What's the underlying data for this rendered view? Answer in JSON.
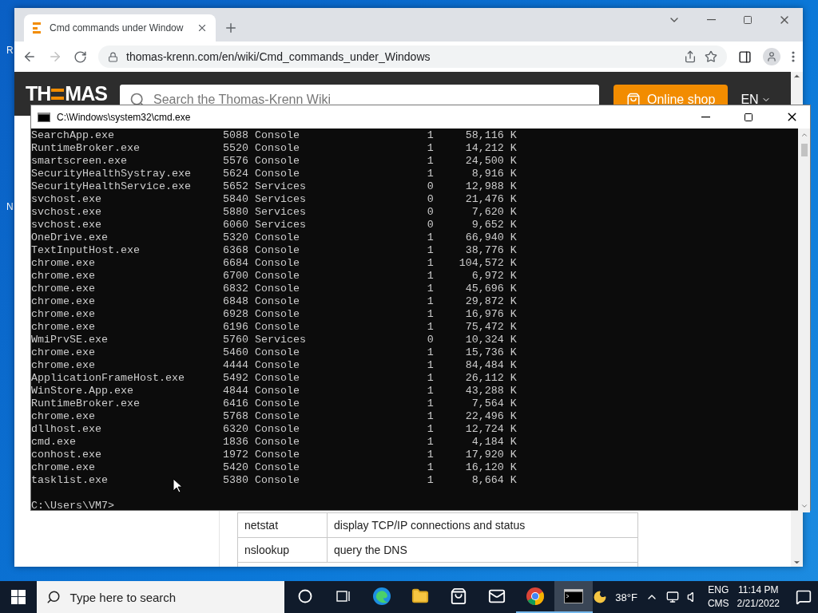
{
  "desktop": {
    "icon_labels": [
      "R",
      "N"
    ]
  },
  "browser": {
    "tabs": [
      {
        "title": "Cmd commands under Window",
        "selected": true
      }
    ],
    "address": "thomas-krenn.com/en/wiki/Cmd_commands_under_Windows",
    "page": {
      "logo": [
        "TH",
        "MAS"
      ],
      "search_placeholder": "Search the Thomas-Krenn Wiki",
      "shop_button": "Online shop",
      "language": "EN",
      "table_rows": [
        [
          "netstat",
          "display TCP/IP connections and status"
        ],
        [
          "nslookup",
          "query the DNS"
        ]
      ]
    }
  },
  "console": {
    "title": "C:\\Windows\\system32\\cmd.exe",
    "processes": [
      {
        "name": "SearchApp.exe",
        "pid": "5088",
        "session": "Console",
        "session_no": "1",
        "mem": "58,116 K"
      },
      {
        "name": "RuntimeBroker.exe",
        "pid": "5520",
        "session": "Console",
        "session_no": "1",
        "mem": "14,212 K"
      },
      {
        "name": "smartscreen.exe",
        "pid": "5576",
        "session": "Console",
        "session_no": "1",
        "mem": "24,500 K"
      },
      {
        "name": "SecurityHealthSystray.exe",
        "pid": "5624",
        "session": "Console",
        "session_no": "1",
        "mem": "8,916 K"
      },
      {
        "name": "SecurityHealthService.exe",
        "pid": "5652",
        "session": "Services",
        "session_no": "0",
        "mem": "12,988 K"
      },
      {
        "name": "svchost.exe",
        "pid": "5840",
        "session": "Services",
        "session_no": "0",
        "mem": "21,476 K"
      },
      {
        "name": "svchost.exe",
        "pid": "5880",
        "session": "Services",
        "session_no": "0",
        "mem": "7,620 K"
      },
      {
        "name": "svchost.exe",
        "pid": "6060",
        "session": "Services",
        "session_no": "0",
        "mem": "9,652 K"
      },
      {
        "name": "OneDrive.exe",
        "pid": "5320",
        "session": "Console",
        "session_no": "1",
        "mem": "66,940 K"
      },
      {
        "name": "TextInputHost.exe",
        "pid": "6368",
        "session": "Console",
        "session_no": "1",
        "mem": "38,776 K"
      },
      {
        "name": "chrome.exe",
        "pid": "6684",
        "session": "Console",
        "session_no": "1",
        "mem": "104,572 K"
      },
      {
        "name": "chrome.exe",
        "pid": "6700",
        "session": "Console",
        "session_no": "1",
        "mem": "6,972 K"
      },
      {
        "name": "chrome.exe",
        "pid": "6832",
        "session": "Console",
        "session_no": "1",
        "mem": "45,696 K"
      },
      {
        "name": "chrome.exe",
        "pid": "6848",
        "session": "Console",
        "session_no": "1",
        "mem": "29,872 K"
      },
      {
        "name": "chrome.exe",
        "pid": "6928",
        "session": "Console",
        "session_no": "1",
        "mem": "16,976 K"
      },
      {
        "name": "chrome.exe",
        "pid": "6196",
        "session": "Console",
        "session_no": "1",
        "mem": "75,472 K"
      },
      {
        "name": "WmiPrvSE.exe",
        "pid": "5760",
        "session": "Services",
        "session_no": "0",
        "mem": "10,324 K"
      },
      {
        "name": "chrome.exe",
        "pid": "5460",
        "session": "Console",
        "session_no": "1",
        "mem": "15,736 K"
      },
      {
        "name": "chrome.exe",
        "pid": "4444",
        "session": "Console",
        "session_no": "1",
        "mem": "84,484 K"
      },
      {
        "name": "ApplicationFrameHost.exe",
        "pid": "5492",
        "session": "Console",
        "session_no": "1",
        "mem": "26,112 K"
      },
      {
        "name": "WinStore.App.exe",
        "pid": "4844",
        "session": "Console",
        "session_no": "1",
        "mem": "43,288 K"
      },
      {
        "name": "RuntimeBroker.exe",
        "pid": "6416",
        "session": "Console",
        "session_no": "1",
        "mem": "7,564 K"
      },
      {
        "name": "chrome.exe",
        "pid": "5768",
        "session": "Console",
        "session_no": "1",
        "mem": "22,496 K"
      },
      {
        "name": "dllhost.exe",
        "pid": "6320",
        "session": "Console",
        "session_no": "1",
        "mem": "12,724 K"
      },
      {
        "name": "cmd.exe",
        "pid": "1836",
        "session": "Console",
        "session_no": "1",
        "mem": "4,184 K"
      },
      {
        "name": "conhost.exe",
        "pid": "1972",
        "session": "Console",
        "session_no": "1",
        "mem": "17,920 K"
      },
      {
        "name": "chrome.exe",
        "pid": "5420",
        "session": "Console",
        "session_no": "1",
        "mem": "16,120 K"
      },
      {
        "name": "tasklist.exe",
        "pid": "5380",
        "session": "Console",
        "session_no": "1",
        "mem": "8,664 K"
      }
    ],
    "prompt": "C:\\Users\\VM7>"
  },
  "taskbar": {
    "search_placeholder": "Type here to search",
    "apps": [
      {
        "kind": "cortana",
        "running": false,
        "selected": false
      },
      {
        "kind": "taskview",
        "running": false,
        "selected": false
      },
      {
        "kind": "edge",
        "running": false,
        "selected": false
      },
      {
        "kind": "explorer",
        "running": false,
        "selected": false
      },
      {
        "kind": "store",
        "running": false,
        "selected": false
      },
      {
        "kind": "mail",
        "running": false,
        "selected": false
      },
      {
        "kind": "chrome",
        "running": true,
        "selected": false
      },
      {
        "kind": "terminal",
        "running": true,
        "selected": true
      }
    ],
    "weather": "38°F",
    "language": [
      "ENG",
      "CMS"
    ],
    "time": "11:14 PM",
    "date": "2/21/2022"
  }
}
